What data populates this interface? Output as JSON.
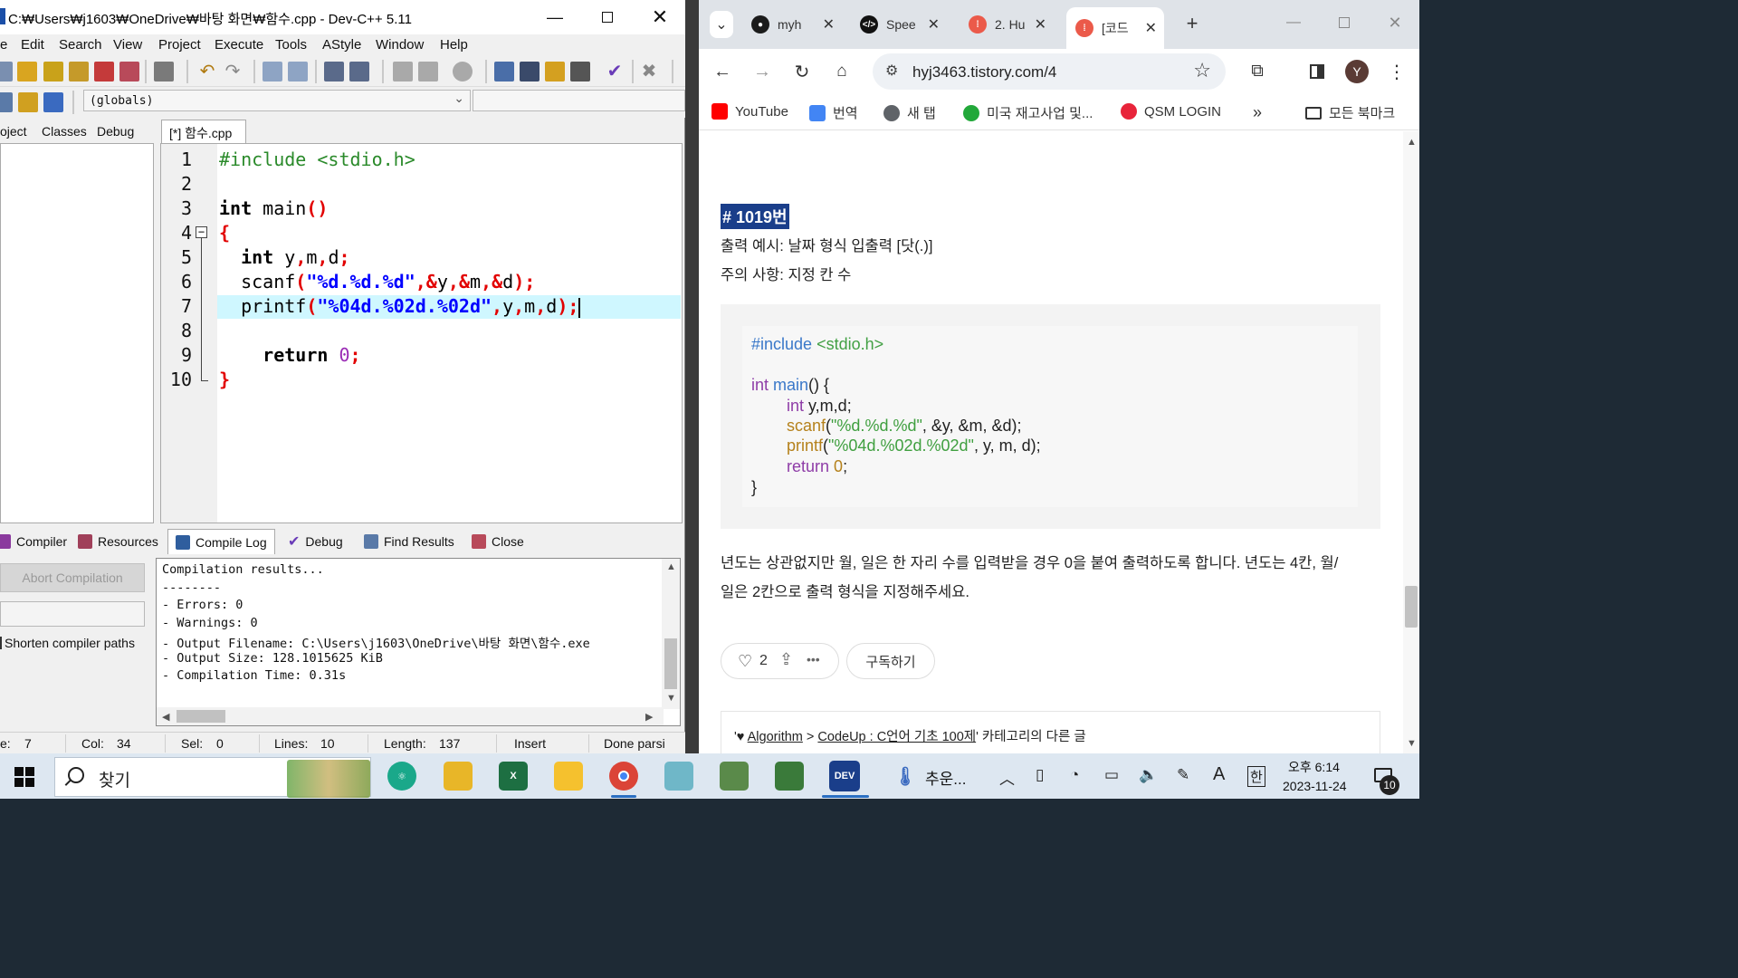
{
  "dev": {
    "title": "C:₩Users₩j1603₩OneDrive₩바탕 화면₩함수.cpp - Dev-C++ 5.11",
    "menu": [
      "e",
      "Edit",
      "Search",
      "View",
      "Project",
      "Execute",
      "Tools",
      "AStyle",
      "Window",
      "Help"
    ],
    "globals": "(globals)",
    "proj_tabs": [
      "oject",
      "Classes",
      "Debug"
    ],
    "file_tab": "[*] 함수.cpp",
    "line_numbers": [
      "1",
      "2",
      "3",
      "4",
      "5",
      "6",
      "7",
      "8",
      "9",
      "10"
    ],
    "bottom_tabs": {
      "compiler": "Compiler",
      "resources": "Resources",
      "compile_log": "Compile Log",
      "debug": "Debug",
      "find_results": "Find Results",
      "close": "Close"
    },
    "abort_label": "Abort Compilation",
    "shorten_label": "Shorten compiler paths",
    "log_lines": [
      "Compilation results...",
      "--------",
      "- Errors: 0",
      "- Warnings: 0",
      "- Output Filename: C:\\Users\\j1603\\OneDrive\\바탕 화면\\함수.exe",
      "- Output Size: 128.1015625 KiB",
      "- Compilation Time: 0.31s"
    ],
    "status": {
      "line_label": "e:",
      "line_value": "7",
      "col_label": "Col:",
      "col_value": "34",
      "sel_label": "Sel:",
      "sel_value": "0",
      "lines_label": "Lines:",
      "lines_value": "10",
      "length_label": "Length:",
      "length_value": "137",
      "mode": "Insert",
      "parse": "Done parsi"
    }
  },
  "chrome": {
    "tabs": [
      {
        "label": "myh",
        "favicon": "github-icon"
      },
      {
        "label": "Spee",
        "favicon": "code-icon"
      },
      {
        "label": "2. Hu",
        "favicon": "tistory-icon"
      },
      {
        "label": "[코드",
        "favicon": "tistory-icon"
      }
    ],
    "url": "hyj3463.tistory.com/4",
    "profile_initial": "Y",
    "bookmarks": [
      {
        "label": "YouTube",
        "color": "#ff0000"
      },
      {
        "label": "번역",
        "color": "#4285f4"
      },
      {
        "label": "새 탭",
        "color": "#5f6368"
      },
      {
        "label": "미국 재고사업 및...",
        "color": "#22a83a"
      },
      {
        "label": "QSM LOGIN",
        "color": "#e8243a"
      }
    ],
    "all_bookmarks": "모든 북마크",
    "page": {
      "heading": "# 1019번",
      "line1": "출력 예시: 날짜 형식 입출력 [닷(.)]",
      "line2": "주의 사항: 지정 칸 수",
      "para1": "년도는 상관없지만 월, 일은 한 자리 수를 입력받을 경우 0을 붙여 출력하도록 합니다. 년도는 4칸, 월/",
      "para2": "일은 2칸으로 출력 형식을 지정해주세요.",
      "like_count": "2",
      "subscribe": "구독하기",
      "cat_category": "Algorithm",
      "cat_sub": "CodeUp : C언어 기초 100제",
      "cat_suffix": "' 카테고리의 다른 글"
    }
  },
  "taskbar": {
    "search": "찾기",
    "weather": "추운...",
    "time": "오후 6:14",
    "date": "2023-11-24",
    "notif_count": "10",
    "ime_lang": "한",
    "ime_mode": "A"
  }
}
